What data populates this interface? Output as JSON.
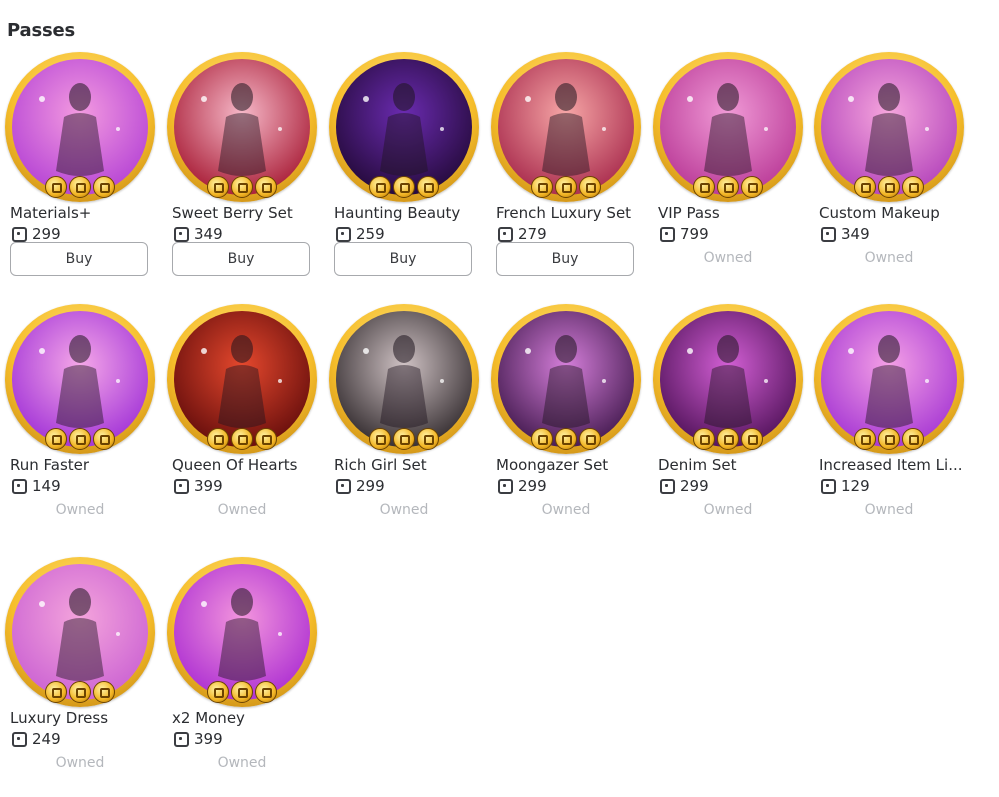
{
  "section": {
    "title": "Passes"
  },
  "passes": [
    {
      "name": "Materials+",
      "price": "299",
      "action": "Buy",
      "status": "buy",
      "colors": [
        "#f39ae0",
        "#b23fd4"
      ]
    },
    {
      "name": "Sweet Berry Set",
      "price": "349",
      "action": "Buy",
      "status": "buy",
      "colors": [
        "#f6b8c8",
        "#a4142e"
      ]
    },
    {
      "name": "Haunting Beauty",
      "price": "259",
      "action": "Buy",
      "status": "buy",
      "colors": [
        "#6a2bb0",
        "#200833"
      ]
    },
    {
      "name": "French Luxury Set",
      "price": "279",
      "action": "Buy",
      "status": "buy",
      "colors": [
        "#f6a6a6",
        "#a42448"
      ]
    },
    {
      "name": "VIP Pass",
      "price": "799",
      "action": "Owned",
      "status": "owned",
      "colors": [
        "#f09ad6",
        "#b73594"
      ]
    },
    {
      "name": "Custom Makeup",
      "price": "349",
      "action": "Owned",
      "status": "owned",
      "colors": [
        "#f6a6dd",
        "#b03fb9"
      ]
    },
    {
      "name": "Run Faster",
      "price": "149",
      "action": "Owned",
      "status": "owned",
      "colors": [
        "#f5a7e8",
        "#9d2dd6"
      ]
    },
    {
      "name": "Queen Of Hearts",
      "price": "399",
      "action": "Owned",
      "status": "owned",
      "colors": [
        "#e5482d",
        "#5e0a0a"
      ]
    },
    {
      "name": "Rich Girl Set",
      "price": "299",
      "action": "Owned",
      "status": "owned",
      "colors": [
        "#cfc2c4",
        "#2a2326"
      ]
    },
    {
      "name": "Moongazer Set",
      "price": "299",
      "action": "Owned",
      "status": "owned",
      "colors": [
        "#d47ed9",
        "#3c1548"
      ]
    },
    {
      "name": "Denim Set",
      "price": "299",
      "action": "Owned",
      "status": "owned",
      "colors": [
        "#d25fd4",
        "#4b0f54"
      ]
    },
    {
      "name": "Increased Item Li...",
      "price": "129",
      "action": "Owned",
      "status": "owned",
      "colors": [
        "#f4a0e6",
        "#a232d2"
      ]
    },
    {
      "name": "Luxury Dress",
      "price": "249",
      "action": "Owned",
      "status": "owned",
      "colors": [
        "#f4a4dc",
        "#c95fd2"
      ]
    },
    {
      "name": "x2 Money",
      "price": "399",
      "action": "Owned",
      "status": "owned",
      "colors": [
        "#f395dd",
        "#a92ad1"
      ]
    }
  ]
}
